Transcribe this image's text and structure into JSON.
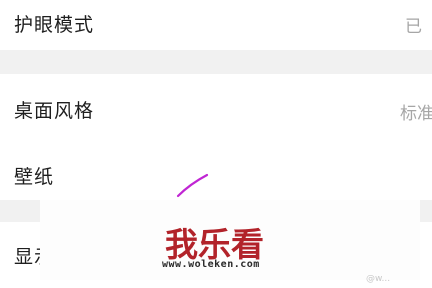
{
  "settings": {
    "eye_mode": {
      "label": "护眼模式",
      "value": "已"
    },
    "desktop_style": {
      "label": "桌面风格",
      "value": "标准"
    },
    "wallpaper": {
      "label": "壁纸"
    },
    "display": {
      "label": "显示"
    }
  },
  "watermark": {
    "logo_text": "我乐看",
    "url": "www.woleken.com",
    "corner_text": "@w..."
  },
  "colors": {
    "logo": "#b2232a",
    "accent_stroke": "#c026d3"
  }
}
